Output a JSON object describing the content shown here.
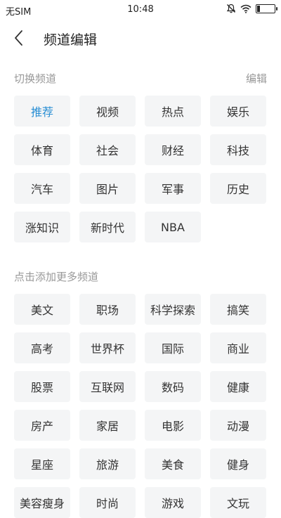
{
  "status_bar": {
    "carrier": "无SIM",
    "time": "10:48",
    "battery_level": 0.15
  },
  "header": {
    "title": "频道编辑"
  },
  "my_channels": {
    "title": "切换频道",
    "edit_label": "编辑",
    "items": [
      {
        "label": "推荐",
        "active": true
      },
      {
        "label": "视频"
      },
      {
        "label": "热点"
      },
      {
        "label": "娱乐"
      },
      {
        "label": "体育"
      },
      {
        "label": "社会"
      },
      {
        "label": "财经"
      },
      {
        "label": "科技"
      },
      {
        "label": "汽车"
      },
      {
        "label": "图片"
      },
      {
        "label": "军事"
      },
      {
        "label": "历史"
      },
      {
        "label": "涨知识"
      },
      {
        "label": "新时代"
      },
      {
        "label": "NBA"
      }
    ]
  },
  "more_channels": {
    "title": "点击添加更多频道",
    "items": [
      {
        "label": "美文"
      },
      {
        "label": "职场"
      },
      {
        "label": "科学探索"
      },
      {
        "label": "搞笑"
      },
      {
        "label": "高考"
      },
      {
        "label": "世界杯"
      },
      {
        "label": "国际"
      },
      {
        "label": "商业"
      },
      {
        "label": "股票"
      },
      {
        "label": "互联网"
      },
      {
        "label": "数码"
      },
      {
        "label": "健康"
      },
      {
        "label": "房产"
      },
      {
        "label": "家居"
      },
      {
        "label": "电影"
      },
      {
        "label": "动漫"
      },
      {
        "label": "星座"
      },
      {
        "label": "旅游"
      },
      {
        "label": "美食"
      },
      {
        "label": "健身"
      },
      {
        "label": "美容瘦身"
      },
      {
        "label": "时尚"
      },
      {
        "label": "游戏"
      },
      {
        "label": "文玩"
      }
    ]
  },
  "colors": {
    "accent": "#2a8fd4",
    "chip_bg": "#f4f5f6"
  }
}
